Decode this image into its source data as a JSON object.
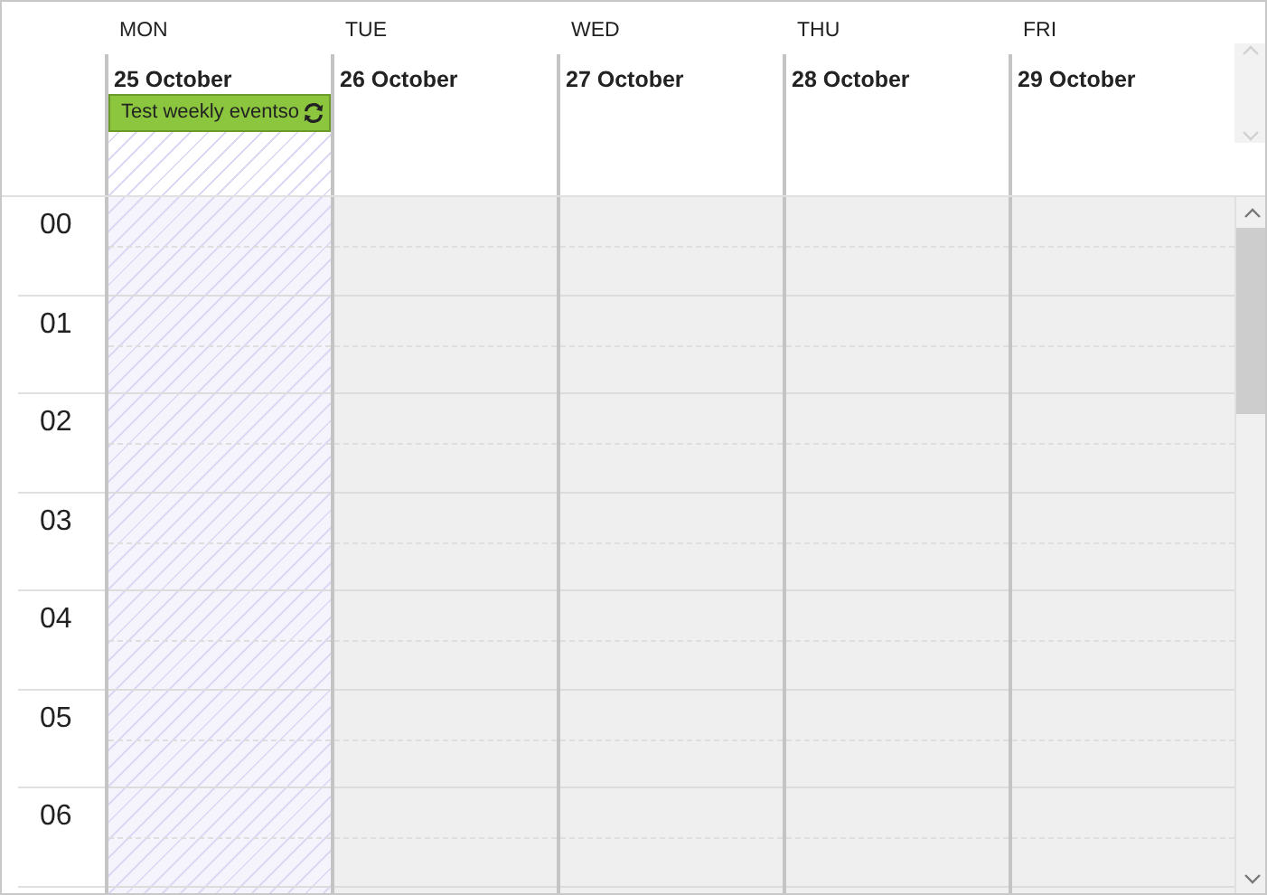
{
  "days": [
    {
      "weekday": "MON",
      "date": "25 October",
      "hatched": true,
      "events": [
        {
          "title": "Test weekly eventso",
          "recurring": true
        }
      ]
    },
    {
      "weekday": "TUE",
      "date": "26 October",
      "hatched": false
    },
    {
      "weekday": "WED",
      "date": "27 October",
      "hatched": false
    },
    {
      "weekday": "THU",
      "date": "28 October",
      "hatched": false
    },
    {
      "weekday": "FRI",
      "date": "29 October",
      "hatched": false
    }
  ],
  "hours": [
    "00",
    "01",
    "02",
    "03",
    "04",
    "05",
    "06"
  ]
}
